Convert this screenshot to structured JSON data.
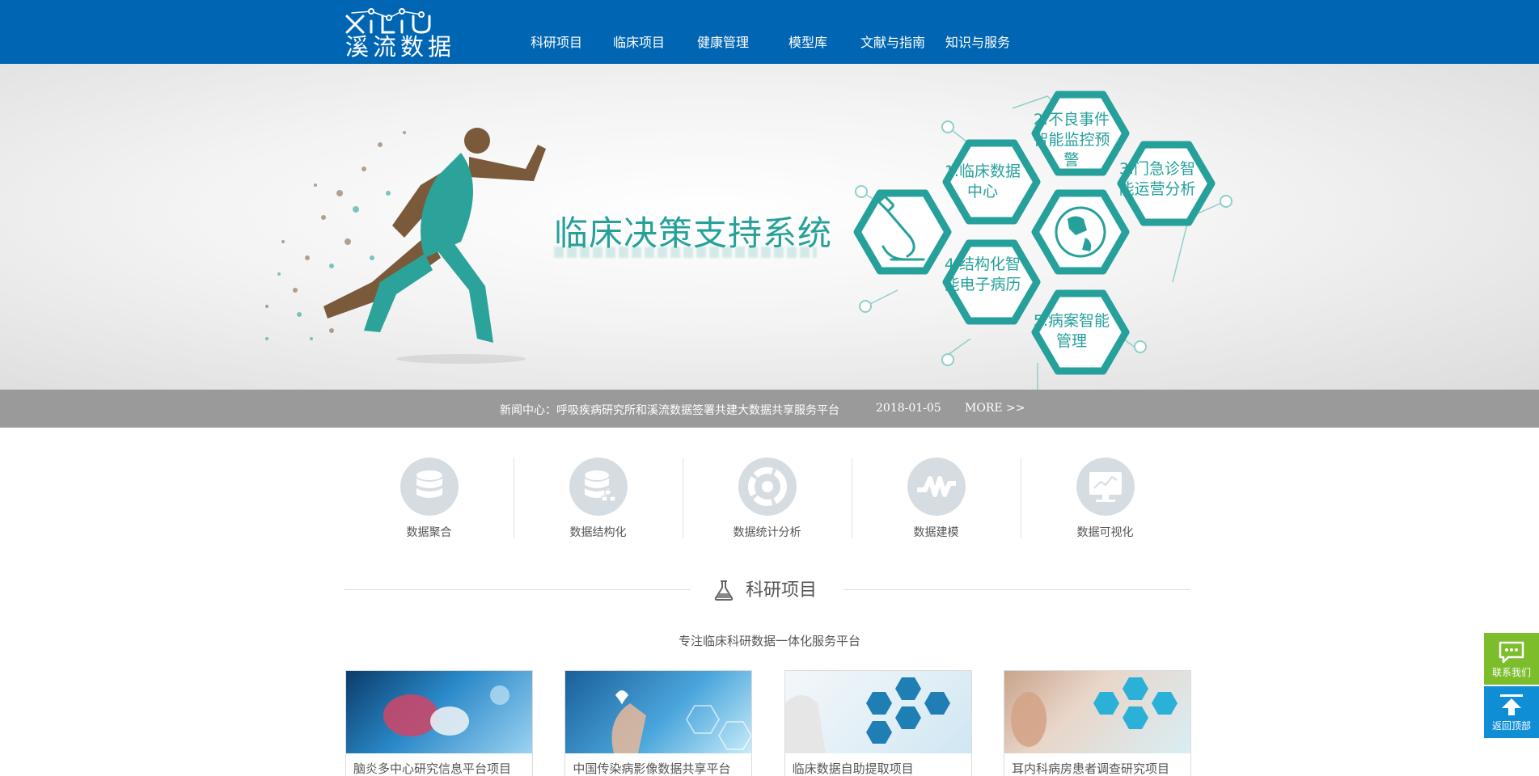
{
  "brand": {
    "logo_latin": "XILIU",
    "logo_cn": "溪流数据"
  },
  "nav": [
    {
      "label": "科研项目"
    },
    {
      "label": "临床项目"
    },
    {
      "label": "健康管理"
    },
    {
      "label": "模型库"
    },
    {
      "label": "文献与指南"
    },
    {
      "label": "知识与服务"
    }
  ],
  "banner": {
    "title": "临床决策支持系统",
    "hex": [
      {
        "label": "1.临床数据中心"
      },
      {
        "label": "2.不良事件智能监控预警"
      },
      {
        "label": "3.门急诊智能运营分析"
      },
      {
        "label": "4.结构化智能电子病历"
      },
      {
        "label": "5.病案智能管理"
      }
    ],
    "accent": "#26a09a"
  },
  "news": {
    "text": "新闻中心：呼吸疾病研究所和溪流数据签署共建大数据共享服务平台",
    "date": "2018-01-05",
    "more": "MORE >>"
  },
  "features": [
    {
      "label": "数据聚合",
      "icon": "database-icon"
    },
    {
      "label": "数据结构化",
      "icon": "database-structure-icon"
    },
    {
      "label": "数据统计分析",
      "icon": "pie-chart-icon"
    },
    {
      "label": "数据建模",
      "icon": "waveform-icon"
    },
    {
      "label": "数据可视化",
      "icon": "monitor-chart-icon"
    }
  ],
  "section": {
    "title": "科研项目",
    "subtitle": "专注临床科研数据一体化服务平台"
  },
  "cards": [
    {
      "title": "脑炎多中心研究信息平台项目"
    },
    {
      "title": "中国传染病影像数据共享平台"
    },
    {
      "title": "临床数据自助提取项目"
    },
    {
      "title": "耳内科病房患者调查研究项目"
    }
  ],
  "side": {
    "contact": "联系我们",
    "top": "返回顶部"
  },
  "colors": {
    "header": "#0066b3",
    "newsbar": "#9a9a9a",
    "contact": "#7cbd2c",
    "backtop": "#0f8ed6"
  }
}
